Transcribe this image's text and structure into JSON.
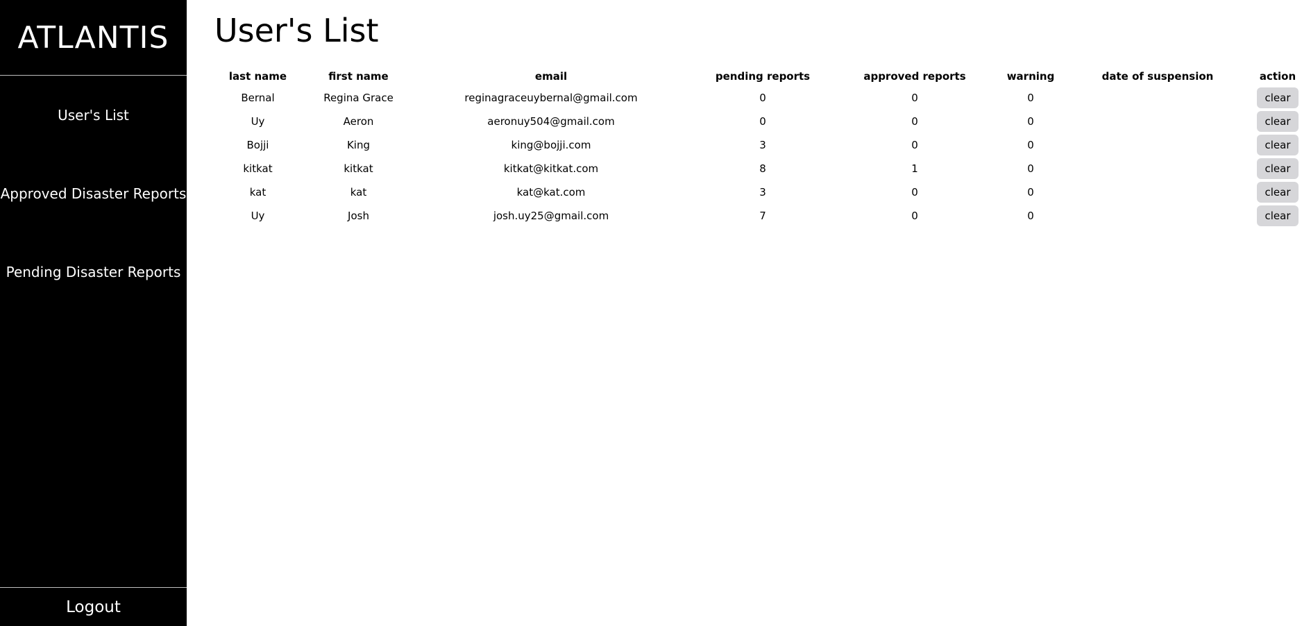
{
  "sidebar": {
    "brand": "ATLANTIS",
    "items": [
      {
        "label": "User's List"
      },
      {
        "label": "Approved Disaster Reports"
      },
      {
        "label": "Pending Disaster Reports"
      }
    ],
    "logout_label": "Logout"
  },
  "main": {
    "title": "User's List",
    "table": {
      "headers": {
        "last_name": "last name",
        "first_name": "first name",
        "email": "email",
        "pending": "pending reports",
        "approved": "approved reports",
        "warning": "warning",
        "suspension": "date of suspension",
        "action": "action"
      },
      "rows": [
        {
          "last_name": "Bernal",
          "first_name": "Regina Grace",
          "email": "reginagraceuybernal@gmail.com",
          "pending": "0",
          "approved": "0",
          "warning": "0",
          "suspension": "",
          "action": "clear"
        },
        {
          "last_name": "Uy",
          "first_name": "Aeron",
          "email": "aeronuy504@gmail.com",
          "pending": "0",
          "approved": "0",
          "warning": "0",
          "suspension": "",
          "action": "clear"
        },
        {
          "last_name": "Bojji",
          "first_name": "King",
          "email": "king@bojji.com",
          "pending": "3",
          "approved": "0",
          "warning": "0",
          "suspension": "",
          "action": "clear"
        },
        {
          "last_name": "kitkat",
          "first_name": "kitkat",
          "email": "kitkat@kitkat.com",
          "pending": "8",
          "approved": "1",
          "warning": "0",
          "suspension": "",
          "action": "clear"
        },
        {
          "last_name": "kat",
          "first_name": "kat",
          "email": "kat@kat.com",
          "pending": "3",
          "approved": "0",
          "warning": "0",
          "suspension": "",
          "action": "clear"
        },
        {
          "last_name": "Uy",
          "first_name": "Josh",
          "email": "josh.uy25@gmail.com",
          "pending": "7",
          "approved": "0",
          "warning": "0",
          "suspension": "",
          "action": "clear"
        }
      ]
    }
  }
}
